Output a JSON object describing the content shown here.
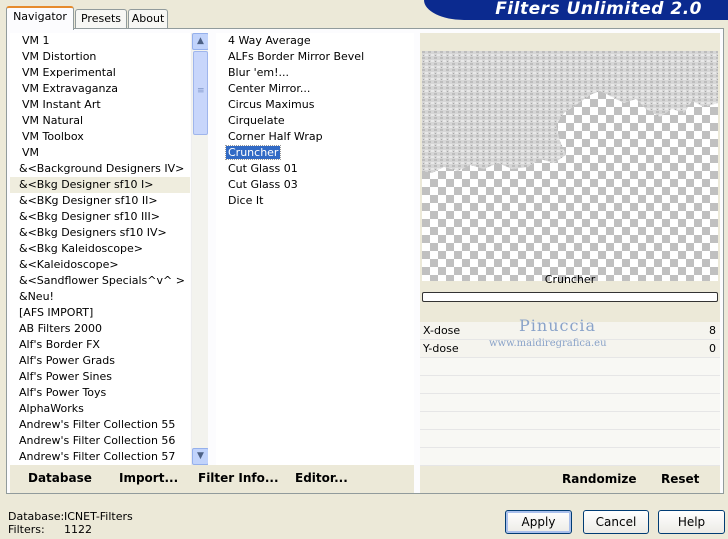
{
  "tabs": [
    "Navigator",
    "Presets",
    "About"
  ],
  "banner": "Filters Unlimited 2.0",
  "categories": [
    "VM 1",
    "VM Distortion",
    "VM Experimental",
    "VM Extravaganza",
    "VM Instant Art",
    "VM Natural",
    "VM Toolbox",
    "VM",
    "&<Background Designers IV>",
    "&<Bkg Designer sf10 I>",
    "&<BKg Designer sf10 II>",
    "&<Bkg Designer sf10 III>",
    "&<Bkg Designers sf10 IV>",
    "&<Bkg Kaleidoscope>",
    "&<Kaleidoscope>",
    "&<Sandflower Specials^v^ >",
    "&Neu!",
    "[AFS IMPORT]",
    "AB Filters 2000",
    "Alf's Border FX",
    "Alf's Power Grads",
    "Alf's Power Sines",
    "Alf's Power Toys",
    "AlphaWorks",
    "Andrew's Filter Collection 55",
    "Andrew's Filter Collection 56",
    "Andrew's Filter Collection 57"
  ],
  "selected_category": "&<Bkg Designer sf10 I>",
  "filters": [
    "4 Way Average",
    "ALFs Border Mirror Bevel",
    "Blur 'em!...",
    "Center Mirror...",
    "Circus Maximus",
    "Cirquelate",
    "Corner Half Wrap",
    "Cruncher",
    "Cut Glass 01",
    "Cut Glass 03",
    "Dice It"
  ],
  "selected_filter": "Cruncher",
  "list_buttons": {
    "database": "Database",
    "import": "Import...",
    "filter_info": "Filter Info...",
    "editor": "Editor..."
  },
  "preview": {
    "filter_name": "Cruncher"
  },
  "params": [
    {
      "label": "X-dose",
      "value": "8"
    },
    {
      "label": "Y-dose",
      "value": "0"
    }
  ],
  "watermark": {
    "name": "Pinuccia",
    "url": "www.maidiregrafica.eu"
  },
  "right_buttons": {
    "randomize": "Randomize",
    "reset": "Reset"
  },
  "status": {
    "db_label": "Database:",
    "db_value": "ICNET-Filters",
    "filters_label": "Filters:",
    "filters_value": "1122"
  },
  "dialog_buttons": {
    "apply": "Apply",
    "cancel": "Cancel",
    "help": "Help"
  },
  "colors": {
    "selection": "#316ac5",
    "banner": "#0b2a8f",
    "tab_accent": "#e68b2c"
  }
}
